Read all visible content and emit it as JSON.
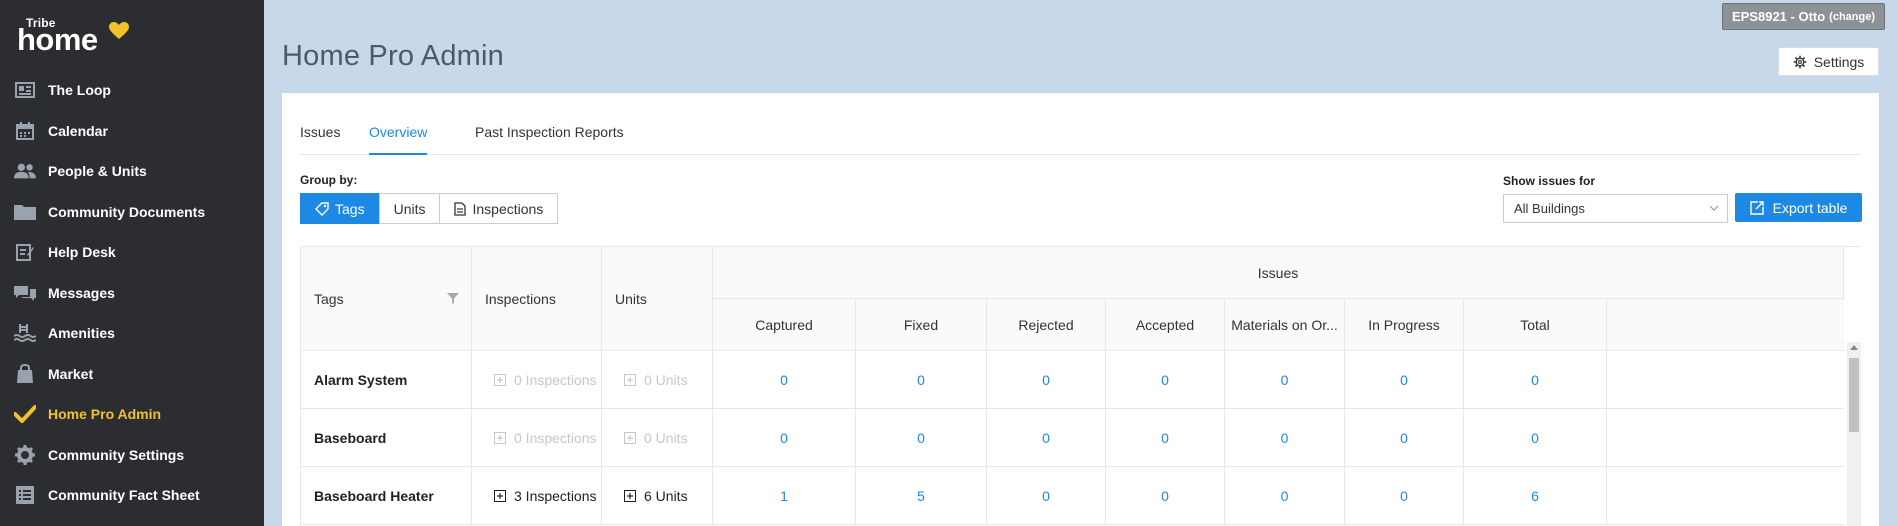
{
  "brand": {
    "small": "Tribe",
    "big": "home"
  },
  "sidebar": {
    "items": [
      {
        "label": "The Loop",
        "icon": "newspaper-icon"
      },
      {
        "label": "Calendar",
        "icon": "calendar-icon"
      },
      {
        "label": "People & Units",
        "icon": "people-icon"
      },
      {
        "label": "Community Documents",
        "icon": "folder-icon"
      },
      {
        "label": "Help Desk",
        "icon": "edit-note-icon"
      },
      {
        "label": "Messages",
        "icon": "chat-icon"
      },
      {
        "label": "Amenities",
        "icon": "pool-icon"
      },
      {
        "label": "Market",
        "icon": "shopping-bag-icon"
      },
      {
        "label": "Home Pro Admin",
        "icon": "checkmark-icon",
        "active": true
      },
      {
        "label": "Community Settings",
        "icon": "gear-icon"
      },
      {
        "label": "Community Fact Sheet",
        "icon": "list-icon"
      }
    ]
  },
  "header": {
    "title": "Home Pro Admin",
    "user": "EPS8921 - Otto",
    "change": "(change)",
    "settings": "Settings"
  },
  "tabs": [
    "Issues",
    "Overview",
    "Past Inspection Reports"
  ],
  "active_tab": "Overview",
  "groupby": {
    "label": "Group by:",
    "options": [
      "Tags",
      "Units",
      "Inspections"
    ],
    "selected": "Tags"
  },
  "filter": {
    "label": "Show issues for",
    "value": "All Buildings"
  },
  "export_label": "Export table",
  "table": {
    "headers": {
      "tags": "Tags",
      "inspections": "Inspections",
      "units": "Units",
      "issues": "Issues"
    },
    "issue_columns": [
      "Captured",
      "Fixed",
      "Rejected",
      "Accepted",
      "Materials on Or...",
      "In Progress",
      "Total"
    ],
    "rows": [
      {
        "tag": "Alarm System",
        "inspections": "0 Inspections",
        "units": "0 Units",
        "values": [
          "0",
          "0",
          "0",
          "0",
          "0",
          "0",
          "0"
        ],
        "dim": true
      },
      {
        "tag": "Baseboard",
        "inspections": "0 Inspections",
        "units": "0 Units",
        "values": [
          "0",
          "0",
          "0",
          "0",
          "0",
          "0",
          "0"
        ],
        "dim": true
      },
      {
        "tag": "Baseboard Heater",
        "inspections": "3 Inspections",
        "units": "6 Units",
        "values": [
          "1",
          "5",
          "0",
          "0",
          "0",
          "0",
          "6"
        ],
        "dim": false
      }
    ]
  },
  "colors": {
    "accent": "#1e88e5",
    "active_nav": "#f3c12a",
    "sidebar": "#2b2d30",
    "background": "#c6d8e9"
  }
}
